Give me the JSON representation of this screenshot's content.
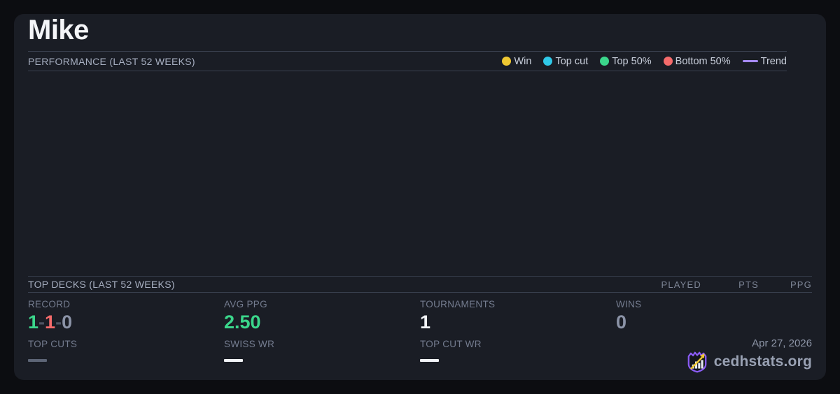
{
  "player": {
    "name": "Mike"
  },
  "performance": {
    "title": "PERFORMANCE (LAST 52 WEEKS)",
    "legend": [
      {
        "label": "Win",
        "color": "#f0c832",
        "marker": "dot"
      },
      {
        "label": "Top cut",
        "color": "#30c9e8",
        "marker": "dot"
      },
      {
        "label": "Top 50%",
        "color": "#3bd68b",
        "marker": "dot"
      },
      {
        "label": "Bottom 50%",
        "color": "#f56b6b",
        "marker": "dot"
      },
      {
        "label": "Trend",
        "color": "#a78bfa",
        "marker": "line"
      }
    ]
  },
  "chart_data": {
    "type": "scatter",
    "series": [],
    "note": "chart area is empty - no plotted points visible"
  },
  "top_decks": {
    "title": "TOP DECKS (LAST 52 WEEKS)",
    "columns": [
      "PLAYED",
      "PTS",
      "PPG"
    ],
    "rows": []
  },
  "stats": {
    "record": {
      "label": "RECORD",
      "wins": "1",
      "losses": "1",
      "draws": "0",
      "separator": "-"
    },
    "avg_ppg": {
      "label": "AVG PPG",
      "value": "2.50"
    },
    "tournaments": {
      "label": "TOURNAMENTS",
      "value": "1"
    },
    "wins": {
      "label": "WINS",
      "value": "0"
    },
    "top_cuts": {
      "label": "TOP CUTS",
      "value": "—",
      "dash_color": "#5d6576"
    },
    "swiss_wr": {
      "label": "SWISS WR",
      "value": "—",
      "dash_color": "#f2f4f8"
    },
    "top_cut_wr": {
      "label": "TOP CUT WR",
      "value": "—",
      "dash_color": "#f2f4f8"
    }
  },
  "footer": {
    "date": "Apr 27, 2026",
    "brand": "cedhstats.org"
  },
  "colors": {
    "background": "#0c0d11",
    "card": "#1a1d25",
    "divider": "#3a4150",
    "green": "#3bd68b",
    "red": "#f56b6b",
    "muted_value": "#8b93a7",
    "white_value": "#f2f4f8",
    "brand_purple": "#8b5cf6",
    "brand_gold": "#f0c832"
  }
}
